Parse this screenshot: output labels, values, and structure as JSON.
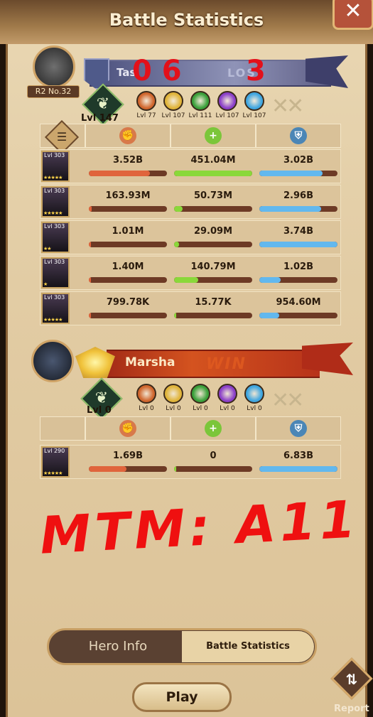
{
  "header": {
    "title": "Battle Statistics",
    "close_icon": "✕"
  },
  "team1": {
    "rank": "R2 No.32",
    "name": "Tas",
    "status": "LOS",
    "tree_level": "Lvl 147",
    "scribble_left": "0 6",
    "scribble_right": "3",
    "gems": [
      {
        "name": "lightbearer",
        "level": "Lvl 77",
        "color": "#d0662d"
      },
      {
        "name": "mauler",
        "level": "Lvl 107",
        "color": "#e0b43a"
      },
      {
        "name": "wilder",
        "level": "Lvl 111",
        "color": "#3aa03a"
      },
      {
        "name": "graveborn",
        "level": "Lvl 107",
        "color": "#8b3fc8"
      },
      {
        "name": "celestial",
        "level": "Lvl 107",
        "color": "#3fa6e0"
      }
    ],
    "rows": [
      {
        "level": "Lvl 303",
        "stars": "★★★★★",
        "damage": "3.52B",
        "heal": "451.04M",
        "shield": "3.02B",
        "damage_pct": 0.78,
        "heal_pct": 1.0,
        "shield_pct": 0.81
      },
      {
        "level": "Lvl 303",
        "stars": "★★★★★",
        "damage": "163.93M",
        "heal": "50.73M",
        "shield": "2.96B",
        "damage_pct": 0.04,
        "heal_pct": 0.11,
        "shield_pct": 0.79
      },
      {
        "level": "Lvl 303",
        "stars": "★★",
        "damage": "1.01M",
        "heal": "29.09M",
        "shield": "3.74B",
        "damage_pct": 0.0,
        "heal_pct": 0.06,
        "shield_pct": 1.0
      },
      {
        "level": "Lvl 303",
        "stars": "★",
        "damage": "1.40M",
        "heal": "140.79M",
        "shield": "1.02B",
        "damage_pct": 0.0,
        "heal_pct": 0.31,
        "shield_pct": 0.27
      },
      {
        "level": "Lvl 303",
        "stars": "★★★★★",
        "damage": "799.78K",
        "heal": "15.77K",
        "shield": "954.60M",
        "damage_pct": 0.0,
        "heal_pct": 0.0,
        "shield_pct": 0.25
      }
    ]
  },
  "team2": {
    "name": "Marsha",
    "status": "WIN",
    "tree_level": "Lvl 0",
    "gems": [
      {
        "name": "lightbearer",
        "level": "Lvl 0",
        "color": "#d0662d"
      },
      {
        "name": "mauler",
        "level": "Lvl 0",
        "color": "#e0b43a"
      },
      {
        "name": "wilder",
        "level": "Lvl 0",
        "color": "#3aa03a"
      },
      {
        "name": "graveborn",
        "level": "Lvl 0",
        "color": "#8b3fc8"
      },
      {
        "name": "celestial",
        "level": "Lvl 0",
        "color": "#3fa6e0"
      }
    ],
    "rows": [
      {
        "level": "Lvl 290",
        "stars": "★★★★★",
        "damage": "1.69B",
        "heal": "0",
        "shield": "6.83B",
        "damage_pct": 0.48,
        "heal_pct": 0.0,
        "shield_pct": 1.0
      }
    ]
  },
  "annotation": "MTM: A11",
  "tabs": {
    "hero_info": "Hero Info",
    "battle_statistics": "Battle Statistics"
  },
  "play_label": "Play",
  "report_label": "Report",
  "colors": {
    "damage": "#e0643c",
    "heal": "#8ad83a",
    "shield": "#62b8ee",
    "bar_track": "#6d3a25"
  }
}
